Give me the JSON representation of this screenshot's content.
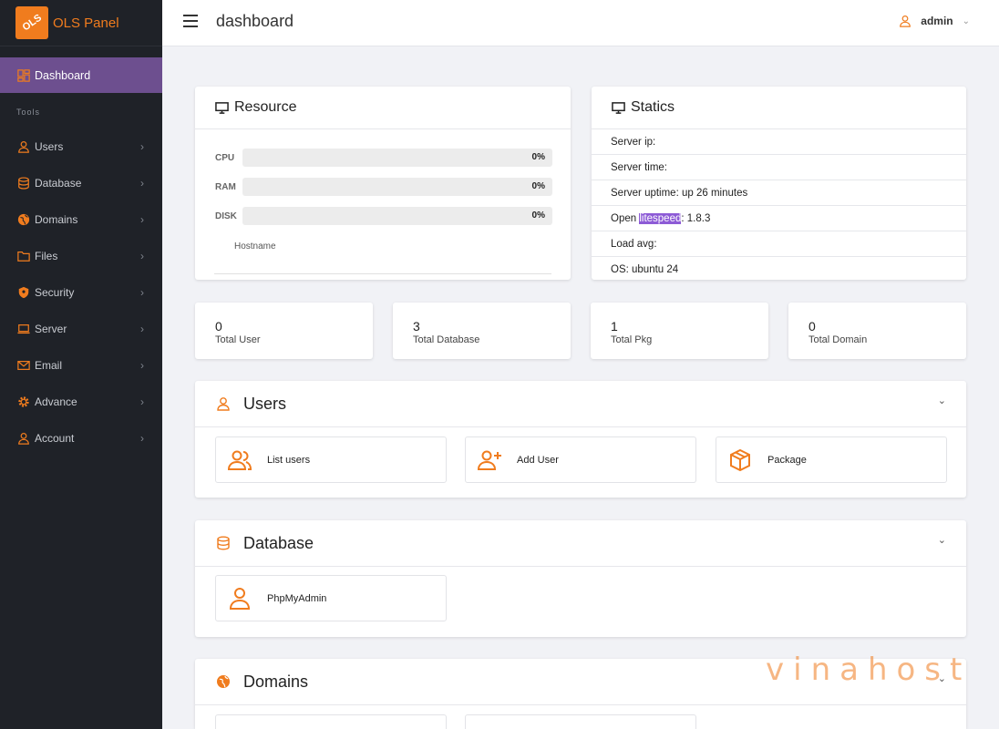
{
  "brand": {
    "logo_text": "OLS",
    "name": "OLS Panel"
  },
  "topbar": {
    "title": "dashboard",
    "username": "admin"
  },
  "sidebar": {
    "active": {
      "label": "Dashboard",
      "icon": "dashboard-icon"
    },
    "section_label": "Tools",
    "items": [
      {
        "label": "Users",
        "icon": "user-icon"
      },
      {
        "label": "Database",
        "icon": "database-icon"
      },
      {
        "label": "Domains",
        "icon": "globe-icon"
      },
      {
        "label": "Files",
        "icon": "folder-icon"
      },
      {
        "label": "Security",
        "icon": "shield-icon"
      },
      {
        "label": "Server",
        "icon": "laptop-icon"
      },
      {
        "label": "Email",
        "icon": "envelope-icon"
      },
      {
        "label": "Advance",
        "icon": "gear-icon"
      },
      {
        "label": "Account",
        "icon": "user-icon"
      }
    ]
  },
  "resource": {
    "title": "Resource",
    "rows": [
      {
        "label": "CPU",
        "value": "0%",
        "fraction": 0
      },
      {
        "label": "RAM",
        "value": "0%",
        "fraction": 0
      },
      {
        "label": "DISK",
        "value": "0%",
        "fraction": 0
      }
    ],
    "hostname_label": "Hostname"
  },
  "statics": {
    "title": "Statics",
    "server_ip": "Server ip:",
    "server_time": "Server time:",
    "server_uptime": "Server uptime: up 26 minutes",
    "open_prefix": "Open ",
    "open_highlight": "litespeed",
    "open_suffix": ": 1.8.3",
    "load_avg": "Load avg:",
    "os": "OS: ubuntu 24"
  },
  "metrics": [
    {
      "value": "0",
      "label": "Total User"
    },
    {
      "value": "3",
      "label": "Total Database"
    },
    {
      "value": "1",
      "label": "Total Pkg"
    },
    {
      "value": "0",
      "label": "Total Domain"
    }
  ],
  "sections": {
    "users": {
      "title": "Users",
      "tiles": [
        "List users",
        "Add User",
        "Package"
      ]
    },
    "database": {
      "title": "Database",
      "tiles": [
        "PhpMyAdmin"
      ]
    },
    "domains": {
      "title": "Domains"
    }
  },
  "watermark": "vinahost",
  "colors": {
    "accent": "#f07c1e",
    "sidebar_bg": "#1f2228",
    "active_bg": "#6d4f8f",
    "highlight": "#8d5bd6"
  }
}
